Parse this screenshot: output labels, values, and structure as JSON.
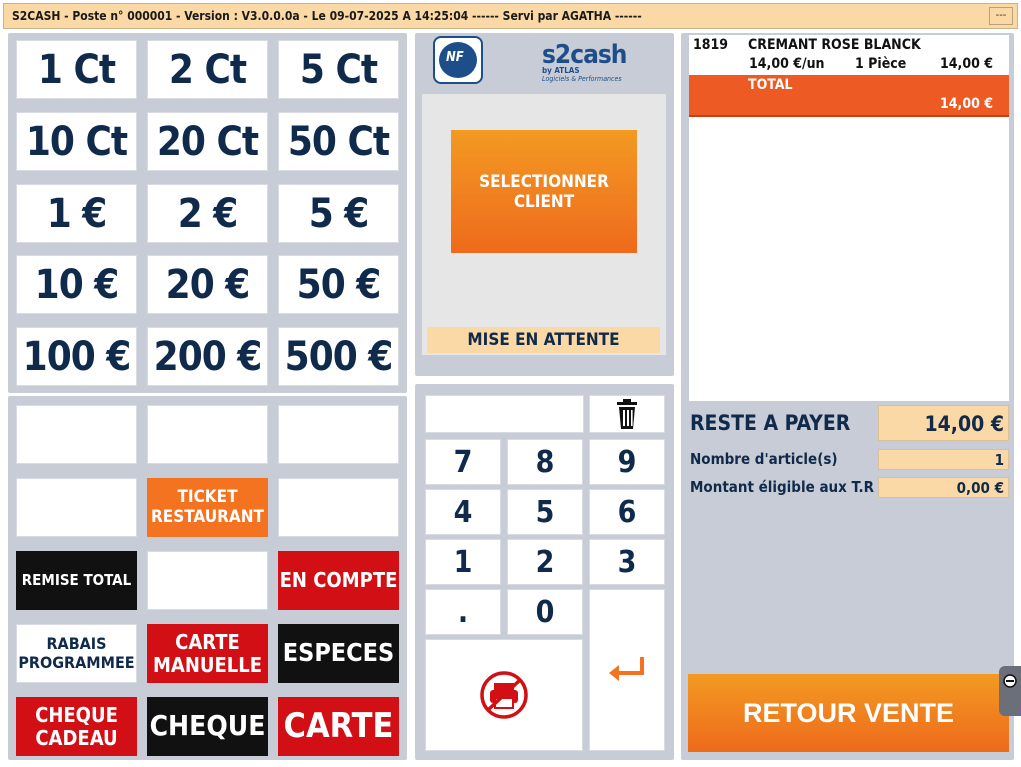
{
  "titlebar": {
    "title": "S2CASH - Poste n° 000001 - Version : V3.0.0.0a - Le 09-07-2025 A 14:25:04 ------ Servi par AGATHA ------",
    "button": "---"
  },
  "coins": [
    "1 Ct",
    "2 Ct",
    "5 Ct",
    "10 Ct",
    "20 Ct",
    "50 Ct",
    "1 €",
    "2 €",
    "5 €",
    "10 €",
    "20 €",
    "50 €",
    "100 €",
    "200 €",
    "500 €"
  ],
  "payments": {
    "ticket_restaurant": "TICKET RESTAURANT",
    "remise_total": "REMISE TOTAL",
    "en_compte": "EN COMPTE",
    "rabais_programmee": "RABAIS PROGRAMMEE",
    "carte_manuelle": "CARTE MANUELLE",
    "especes": "ESPECES",
    "cheque_cadeau": "CHEQUE CADEAU",
    "cheque": "CHEQUE",
    "carte": "CARTE"
  },
  "logos": {
    "nf": "NF",
    "s2cash_main": "s2cash",
    "s2cash_sub": "by ATLAS",
    "s2cash_tag": "Logiciels & Performances"
  },
  "client": {
    "select_label": "SELECTIONNER CLIENT",
    "hold_label": "MISE EN ATTENTE"
  },
  "keypad": {
    "keys": [
      "7",
      "8",
      "9",
      "4",
      "5",
      "6",
      "1",
      "2",
      "3",
      ".",
      "0"
    ],
    "display": ""
  },
  "ticket": {
    "lines": [
      {
        "code": "1819",
        "name": "CREMANT ROSE BLANCK",
        "unit_price": "14,00 €/un",
        "qty": "1 Pièce",
        "amount": "14,00 €"
      }
    ],
    "total_label": "TOTAL",
    "total_value": "14,00 €"
  },
  "summary": {
    "reste_label": "RESTE A PAYER",
    "reste_value": "14,00 €",
    "articles_label": "Nombre d'article(s)",
    "articles_value": "1",
    "tr_label": "Montant éligible aux T.R",
    "tr_value": "0,00 €"
  },
  "retour_label": "RETOUR VENTE",
  "colors": {
    "accent_orange": "#f47320",
    "red": "#d20f14",
    "navy": "#0f2a4a",
    "panel": "#c8ccd6",
    "peach": "#fbd9a6"
  }
}
